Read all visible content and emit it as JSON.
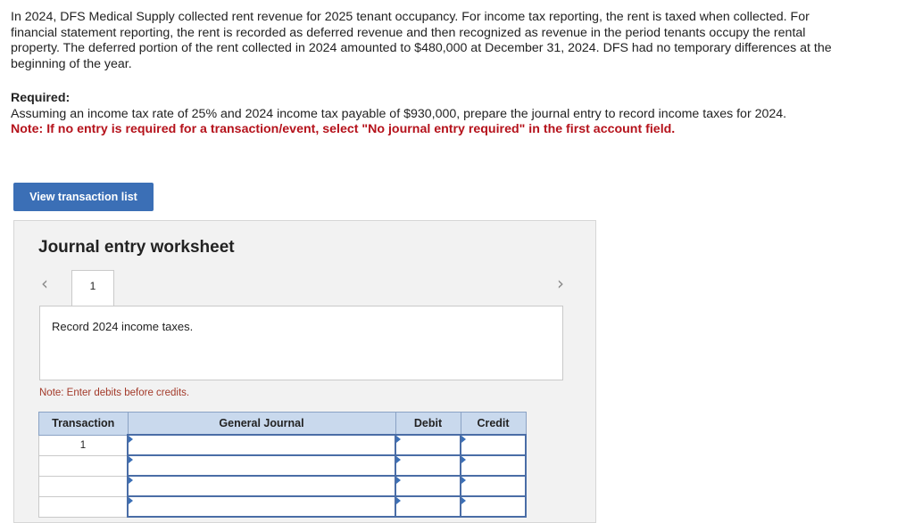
{
  "problem": {
    "paragraph": "In 2024, DFS Medical Supply collected rent revenue for 2025 tenant occupancy. For income tax reporting, the rent is taxed when collected. For financial statement reporting, the rent is recorded as deferred revenue and then recognized as revenue in the period tenants occupy the rental property. The deferred portion of the rent collected in 2024 amounted to $480,000 at December 31, 2024. DFS had no temporary differences at the beginning of the year."
  },
  "required": {
    "title": "Required:",
    "text": "Assuming an income tax rate of 25% and 2024 income tax payable of $930,000, prepare the journal entry to record income taxes for 2024.",
    "note": "Note: If no entry is required for a transaction/event, select \"No journal entry required\" in the first account field."
  },
  "buttons": {
    "view_transactions": "View transaction list"
  },
  "worksheet": {
    "title": "Journal entry worksheet",
    "prev_icon": "‹",
    "next_icon": "›",
    "active_tab": "1",
    "description": "Record 2024 income taxes.",
    "note": "Note: Enter debits before credits.",
    "columns": {
      "transaction": "Transaction",
      "journal": "General Journal",
      "debit": "Debit",
      "credit": "Credit"
    },
    "rows": [
      {
        "transaction": "1",
        "account": "",
        "debit": "",
        "credit": ""
      },
      {
        "transaction": "",
        "account": "",
        "debit": "",
        "credit": ""
      },
      {
        "transaction": "",
        "account": "",
        "debit": "",
        "credit": ""
      },
      {
        "transaction": "",
        "account": "",
        "debit": "",
        "credit": ""
      }
    ]
  },
  "colors": {
    "button_blue": "#3b6fb6",
    "note_red": "#b5121b",
    "header_blue": "#c9d9ed"
  }
}
